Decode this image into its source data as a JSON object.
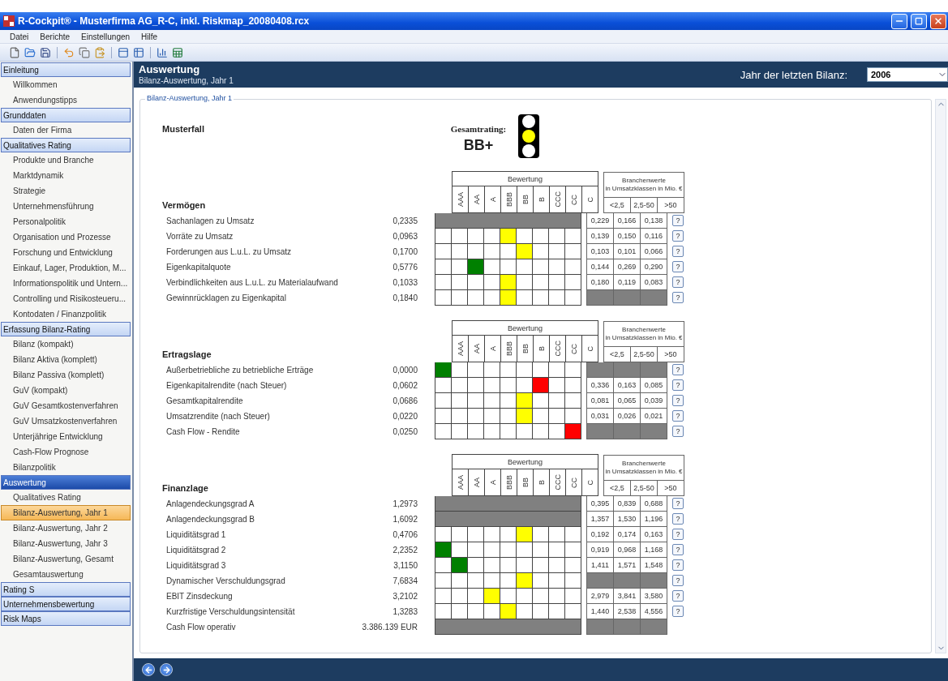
{
  "window": {
    "title": "R-Cockpit® - Musterfirma AG_R-C, inkl. Riskmap_20080408.rcx"
  },
  "menu": [
    "Datei",
    "Berichte",
    "Einstellungen",
    "Hilfe"
  ],
  "sidebar": [
    {
      "label": "Einleitung",
      "selected": false,
      "items": [
        {
          "label": "Willkommen",
          "selected": false
        },
        {
          "label": "Anwendungstipps",
          "selected": false
        }
      ]
    },
    {
      "label": "Grunddaten",
      "selected": false,
      "items": [
        {
          "label": "Daten der Firma",
          "selected": false
        }
      ]
    },
    {
      "label": "Qualitatives Rating",
      "selected": false,
      "items": [
        {
          "label": "Produkte und Branche",
          "selected": false
        },
        {
          "label": "Marktdynamik",
          "selected": false
        },
        {
          "label": "Strategie",
          "selected": false
        },
        {
          "label": "Unternehmensführung",
          "selected": false
        },
        {
          "label": "Personalpolitik",
          "selected": false
        },
        {
          "label": "Organisation und Prozesse",
          "selected": false
        },
        {
          "label": "Forschung und Entwicklung",
          "selected": false
        },
        {
          "label": "Einkauf, Lager, Produktion, M...",
          "selected": false
        },
        {
          "label": "Informationspolitik und Untern...",
          "selected": false
        },
        {
          "label": "Controlling und Risikosteueru...",
          "selected": false
        },
        {
          "label": "Kontodaten / Finanzpolitik",
          "selected": false
        }
      ]
    },
    {
      "label": "Erfassung Bilanz-Rating",
      "selected": false,
      "items": [
        {
          "label": "Bilanz (kompakt)",
          "selected": false
        },
        {
          "label": "Bilanz Aktiva (komplett)",
          "selected": false
        },
        {
          "label": "Bilanz Passiva (komplett)",
          "selected": false
        },
        {
          "label": "GuV (kompakt)",
          "selected": false
        },
        {
          "label": "GuV Gesamtkostenverfahren",
          "selected": false
        },
        {
          "label": "GuV Umsatzkostenverfahren",
          "selected": false
        },
        {
          "label": "Unterjährige Entwicklung",
          "selected": false
        },
        {
          "label": "Cash-Flow Prognose",
          "selected": false
        },
        {
          "label": "Bilanzpolitik",
          "selected": false
        }
      ]
    },
    {
      "label": "Auswertung",
      "selected": true,
      "items": [
        {
          "label": "Qualitatives Rating",
          "selected": false
        },
        {
          "label": "Bilanz-Auswertung, Jahr 1",
          "selected": true
        },
        {
          "label": "Bilanz-Auswertung, Jahr 2",
          "selected": false
        },
        {
          "label": "Bilanz-Auswertung, Jahr 3",
          "selected": false
        },
        {
          "label": "Bilanz-Auswertung, Gesamt",
          "selected": false
        },
        {
          "label": "Gesamtauswertung",
          "selected": false
        }
      ]
    },
    {
      "label": "Rating S",
      "selected": false
    },
    {
      "label": "Unternehmensbewertung",
      "selected": false
    },
    {
      "label": "Risk Maps",
      "selected": false
    }
  ],
  "header": {
    "title": "Auswertung",
    "subtitle": "Bilanz-Auswertung, Jahr 1",
    "year_label": "Jahr der letzten Bilanz:",
    "year_value": "2006"
  },
  "panel": {
    "legend": "Bilanz-Auswertung, Jahr 1",
    "case": "Musterfall",
    "overall_label": "Gesamtrating:",
    "overall_rating": "BB+",
    "traffic_light": [
      {
        "lit": false
      },
      {
        "lit": true
      },
      {
        "lit": false
      }
    ]
  },
  "sections": [
    {
      "title": "Vermögen",
      "rating_header": "Bewertung",
      "rating_columns": [
        "AAA",
        "AA",
        "A",
        "BBB",
        "BB",
        "B",
        "CCC",
        "CC",
        "C"
      ],
      "industry_header": "Branchenwerte",
      "industry_subheader": "in Umsatzklassen in Mio. €",
      "industry_columns": [
        "<2,5",
        "2,5-50",
        ">50"
      ],
      "rows": [
        {
          "label": "Sachanlagen zu Umsatz",
          "value": "0,2335",
          "kind": "na",
          "industry": [
            "0,229",
            "0,166",
            "0,138"
          ],
          "help": "?"
        },
        {
          "label": "Vorräte zu Umsatz",
          "value": "0,0963",
          "kind": "rated",
          "cells": [
            false,
            false,
            false,
            false,
            true,
            false,
            false,
            false,
            false
          ],
          "color": "#ffff00",
          "industry": [
            "0,139",
            "0,150",
            "0,116"
          ],
          "help": "?"
        },
        {
          "label": "Forderungen aus L.u.L. zu Umsatz",
          "value": "0,1700",
          "kind": "rated",
          "cells": [
            false,
            false,
            false,
            false,
            false,
            true,
            false,
            false,
            false
          ],
          "color": "#ffff00",
          "industry": [
            "0,103",
            "0,101",
            "0,066"
          ],
          "help": "?"
        },
        {
          "label": "Eigenkapitalquote",
          "value": "0,5776",
          "kind": "rated",
          "cells": [
            false,
            false,
            true,
            false,
            false,
            false,
            false,
            false,
            false
          ],
          "color": "#008000",
          "industry": [
            "0,144",
            "0,269",
            "0,290"
          ],
          "help": "?"
        },
        {
          "label": "Verbindlichkeiten aus L.u.L. zu Materialaufwand",
          "value": "0,1033",
          "kind": "rated",
          "cells": [
            false,
            false,
            false,
            false,
            true,
            false,
            false,
            false,
            false
          ],
          "color": "#ffff00",
          "industry": [
            "0,180",
            "0,119",
            "0,083"
          ],
          "help": "?"
        },
        {
          "label": "Gewinnrücklagen zu Eigenkapital",
          "value": "0,1840",
          "kind": "rated",
          "cells": [
            false,
            false,
            false,
            false,
            true,
            false,
            false,
            false,
            false
          ],
          "color": "#ffff00",
          "help": "?"
        }
      ]
    },
    {
      "title": "Ertragslage",
      "rating_header": "Bewertung",
      "rating_columns": [
        "AAA",
        "AA",
        "A",
        "BBB",
        "BB",
        "B",
        "CCC",
        "CC",
        "C"
      ],
      "industry_header": "Branchenwerte",
      "industry_subheader": "in Umsatzklassen in Mio. €",
      "industry_columns": [
        "<2,5",
        "2,5-50",
        ">50"
      ],
      "rows": [
        {
          "label": "Außerbetriebliche zu betriebliche Erträge",
          "value": "0,0000",
          "kind": "rated",
          "cells": [
            true,
            false,
            false,
            false,
            false,
            false,
            false,
            false,
            false
          ],
          "color": "#008000",
          "help": "?"
        },
        {
          "label": "Eigenkapitalrendite (nach Steuer)",
          "value": "0,0602",
          "kind": "rated",
          "cells": [
            false,
            false,
            false,
            false,
            false,
            false,
            true,
            false,
            false
          ],
          "color": "#ff0000",
          "industry": [
            "0,336",
            "0,163",
            "0,085"
          ],
          "help": "?"
        },
        {
          "label": "Gesamtkapitalrendite",
          "value": "0,0686",
          "kind": "rated",
          "cells": [
            false,
            false,
            false,
            false,
            false,
            true,
            false,
            false,
            false
          ],
          "color": "#ffff00",
          "industry": [
            "0,081",
            "0,065",
            "0,039"
          ],
          "help": "?"
        },
        {
          "label": "Umsatzrendite (nach Steuer)",
          "value": "0,0220",
          "kind": "rated",
          "cells": [
            false,
            false,
            false,
            false,
            false,
            true,
            false,
            false,
            false
          ],
          "color": "#ffff00",
          "industry": [
            "0,031",
            "0,026",
            "0,021"
          ],
          "help": "?"
        },
        {
          "label": "Cash Flow - Rendite",
          "value": "0,0250",
          "kind": "rated",
          "cells": [
            false,
            false,
            false,
            false,
            false,
            false,
            false,
            false,
            true
          ],
          "color": "#ff0000",
          "help": "?"
        }
      ]
    },
    {
      "title": "Finanzlage",
      "rating_header": "Bewertung",
      "rating_columns": [
        "AAA",
        "AA",
        "A",
        "BBB",
        "BB",
        "B",
        "CCC",
        "CC",
        "C"
      ],
      "industry_header": "Branchenwerte",
      "industry_subheader": "in Umsatzklassen in Mio. €",
      "industry_columns": [
        "<2,5",
        "2,5-50",
        ">50"
      ],
      "rows": [
        {
          "label": "Anlagendeckungsgrad A",
          "value": "1,2973",
          "kind": "na",
          "industry": [
            "0,395",
            "0,839",
            "0,688"
          ],
          "help": "?"
        },
        {
          "label": "Anlagendeckungsgrad B",
          "value": "1,6092",
          "kind": "na",
          "industry": [
            "1,357",
            "1,530",
            "1,196"
          ],
          "help": "?"
        },
        {
          "label": "Liquiditätsgrad 1",
          "value": "0,4706",
          "kind": "rated",
          "cells": [
            false,
            false,
            false,
            false,
            false,
            true,
            false,
            false,
            false
          ],
          "color": "#ffff00",
          "industry": [
            "0,192",
            "0,174",
            "0,163"
          ],
          "help": "?"
        },
        {
          "label": "Liquiditätsgrad 2",
          "value": "2,2352",
          "kind": "rated",
          "cells": [
            true,
            false,
            false,
            false,
            false,
            false,
            false,
            false,
            false
          ],
          "color": "#008000",
          "industry": [
            "0,919",
            "0,968",
            "1,168"
          ],
          "help": "?"
        },
        {
          "label": "Liquiditätsgrad 3",
          "value": "3,1150",
          "kind": "rated",
          "cells": [
            false,
            true,
            false,
            false,
            false,
            false,
            false,
            false,
            false
          ],
          "color": "#008000",
          "industry": [
            "1,411",
            "1,571",
            "1,548"
          ],
          "help": "?"
        },
        {
          "label": "Dynamischer Verschuldungsgrad",
          "value": "7,6834",
          "kind": "rated",
          "cells": [
            false,
            false,
            false,
            false,
            false,
            true,
            false,
            false,
            false
          ],
          "color": "#ffff00",
          "help": "?"
        },
        {
          "label": "EBIT Zinsdeckung",
          "value": "3,2102",
          "kind": "rated",
          "cells": [
            false,
            false,
            false,
            true,
            false,
            false,
            false,
            false,
            false
          ],
          "color": "#ffff00",
          "industry": [
            "2,979",
            "3,841",
            "3,580"
          ],
          "help": "?"
        },
        {
          "label": "Kurzfristige Verschuldungsintensität",
          "value": "1,3283",
          "kind": "rated",
          "cells": [
            false,
            false,
            false,
            false,
            true,
            false,
            false,
            false,
            false
          ],
          "color": "#ffff00",
          "industry": [
            "1,440",
            "2,538",
            "4,556"
          ],
          "help": "?"
        },
        {
          "label": "Cash Flow operativ",
          "value": "3.386.139 EUR",
          "kind": "na"
        }
      ]
    }
  ]
}
